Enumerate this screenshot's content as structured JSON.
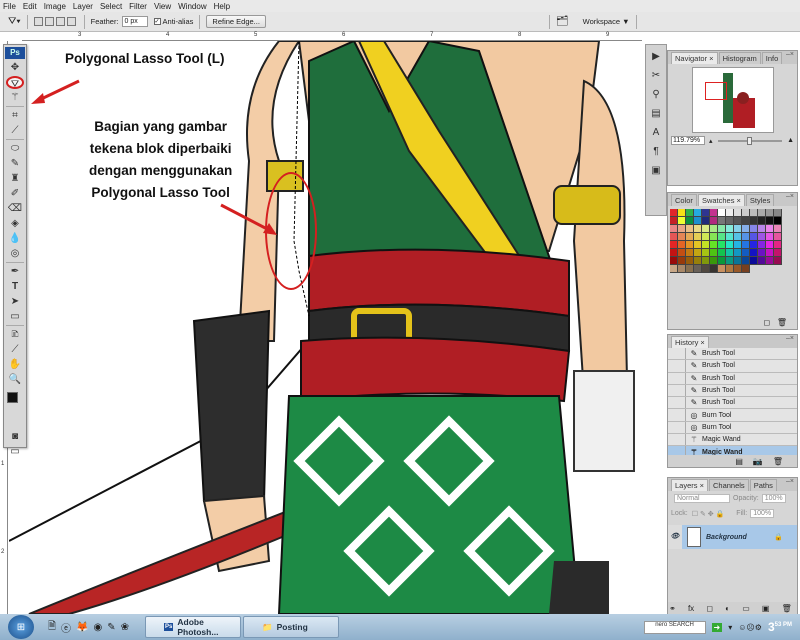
{
  "menu": [
    "File",
    "Edit",
    "Image",
    "Layer",
    "Select",
    "Filter",
    "View",
    "Window",
    "Help"
  ],
  "options": {
    "feather_label": "Feather:",
    "feather_value": "0 px",
    "antialias_label": "Anti-alias",
    "antialias_checked": true,
    "refine_label": "Refine Edge...",
    "workspace_label": "Workspace ▼"
  },
  "ruler_top": [
    "3",
    "4",
    "5",
    "6",
    "7",
    "8",
    "9"
  ],
  "ruler_left": [
    "1",
    "2"
  ],
  "toolbox": {
    "logo": "Ps",
    "tools": [
      "move",
      "marquee",
      "polygonal-lasso",
      "magic-wand",
      "crop",
      "eyedropper",
      "healing",
      "brush",
      "stamp",
      "history-brush",
      "eraser",
      "paint-bucket",
      "blur",
      "dodge",
      "pen",
      "type",
      "path-select",
      "rectangle",
      "notes",
      "eyedropper2",
      "hand",
      "zoom"
    ],
    "selected": "polygonal-lasso",
    "fg_color": "#111111",
    "bg_color": "#ffffff"
  },
  "annotations": {
    "title": "Polygonal Lasso Tool (L)",
    "note_lines": [
      "Bagian yang gambar",
      "tekena blok diperbaiki",
      "dengan menggunakan",
      "Polygonal Lasso Tool"
    ],
    "color": "#d42020"
  },
  "navigator": {
    "tabs": [
      "Navigator ×",
      "Histogram",
      "Info"
    ],
    "zoom": "119.79%"
  },
  "swatches": {
    "tabs": [
      "Color",
      "Swatches ×",
      "Styles"
    ]
  },
  "history": {
    "tabs": [
      "History ×"
    ],
    "items": [
      {
        "label": "Brush Tool",
        "icon": "brush"
      },
      {
        "label": "Brush Tool",
        "icon": "brush"
      },
      {
        "label": "Brush Tool",
        "icon": "brush"
      },
      {
        "label": "Brush Tool",
        "icon": "brush"
      },
      {
        "label": "Brush Tool",
        "icon": "brush"
      },
      {
        "label": "Burn Tool",
        "icon": "burn"
      },
      {
        "label": "Burn Tool",
        "icon": "burn"
      },
      {
        "label": "Magic Wand",
        "icon": "wand"
      },
      {
        "label": "Magic Wand",
        "icon": "wand",
        "selected": true
      }
    ]
  },
  "layers": {
    "tabs": [
      "Layers ×",
      "Channels",
      "Paths"
    ],
    "blend": "Normal",
    "opacity_label": "Opacity:",
    "opacity": "100%",
    "lock_label": "Lock:",
    "fill_label": "Fill:",
    "fill": "100%",
    "layer_name": "Background"
  },
  "taskbar": {
    "tasks": [
      {
        "label": "Adobe Photosh...",
        "icon": "Ps",
        "active": true
      },
      {
        "label": "Posting",
        "icon": "folder"
      }
    ],
    "nero": "nero SEARCH",
    "clock_hour": "3",
    "clock_min": "53",
    "clock_ampm": "PM"
  }
}
